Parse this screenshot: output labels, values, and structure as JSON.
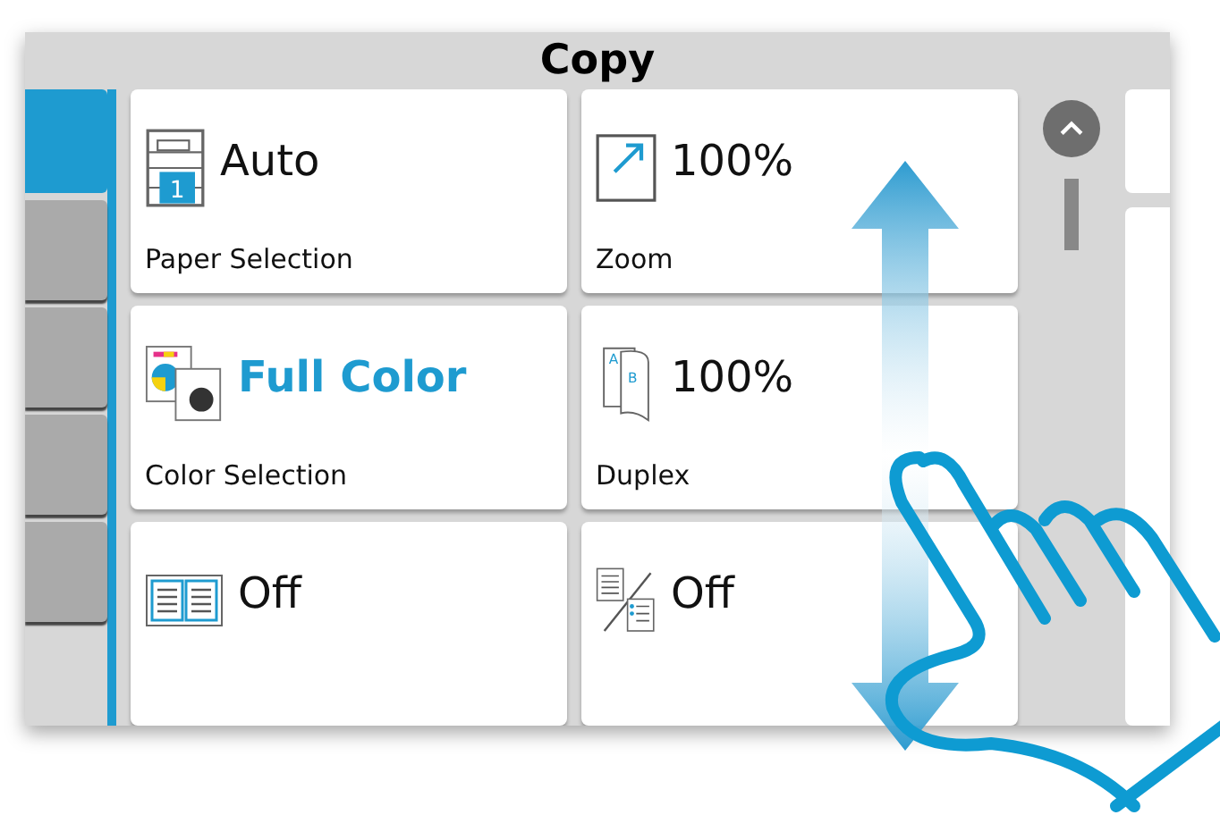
{
  "title": "Copy",
  "side_tabs": [
    {
      "selected": true
    },
    {
      "selected": false
    },
    {
      "selected": false
    },
    {
      "selected": false
    },
    {
      "selected": false
    }
  ],
  "settings": [
    {
      "kind": "paper",
      "icon_text": [
        "1"
      ],
      "value": "Auto",
      "label": "Paper Selection",
      "highlighted": false
    },
    {
      "kind": "zoom",
      "value": "100%",
      "label": "Zoom",
      "highlighted": false
    },
    {
      "kind": "color",
      "value": "Full Color",
      "label": "Color Selection",
      "highlighted": true
    },
    {
      "kind": "duplex",
      "icon_text": [
        "A",
        "B"
      ],
      "value": "100%",
      "label": "Duplex",
      "highlighted": false
    },
    {
      "kind": "book",
      "value": "Off",
      "highlighted": false
    },
    {
      "kind": "combine",
      "value": "Off",
      "highlighted": false
    }
  ]
}
